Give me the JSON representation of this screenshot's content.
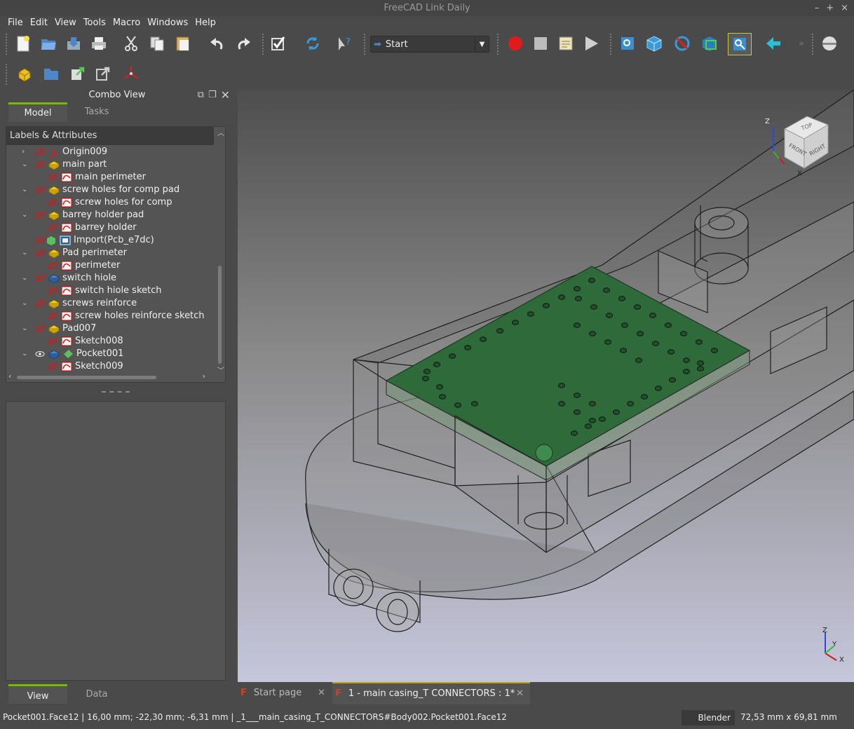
{
  "window": {
    "title": "FreeCAD Link Daily",
    "controls": [
      "–",
      "+",
      "×"
    ]
  },
  "menu": [
    "File",
    "Edit",
    "View",
    "Tools",
    "Macro",
    "Windows",
    "Help"
  ],
  "toolbar": {
    "workbench": "Start",
    "icons": [
      "new-file-icon",
      "open-file-icon",
      "save-icon",
      "print-icon",
      "cut-icon",
      "copy-icon",
      "paste-icon",
      "undo-icon",
      "redo-icon",
      "refresh-check-icon",
      "recompute-icon",
      "whats-this-icon",
      "record-macro-icon",
      "stop-macro-icon",
      "edit-macro-icon",
      "run-macro-icon",
      "fit-all-icon",
      "isometric-view-icon",
      "draw-style-icon",
      "bounding-box-icon",
      "fit-selection-icon",
      "back-arrow-icon",
      "view-menu-icon"
    ]
  },
  "combo": {
    "title": "Combo View",
    "tabs": [
      "Model",
      "Tasks"
    ],
    "tree_header": "Labels & Attributes",
    "items": [
      {
        "label": "Origin009",
        "indent": 0,
        "expand": ">",
        "icon": "origin"
      },
      {
        "label": "main part",
        "indent": 0,
        "expand": "v",
        "icon": "pad"
      },
      {
        "label": "main perimeter",
        "indent": 1,
        "expand": "",
        "icon": "sketch"
      },
      {
        "label": "screw holes for comp pad",
        "indent": 0,
        "expand": "v",
        "icon": "pad"
      },
      {
        "label": "screw holes for comp",
        "indent": 1,
        "expand": "",
        "icon": "sketch"
      },
      {
        "label": "barrey holder pad",
        "indent": 0,
        "expand": "v",
        "icon": "pad"
      },
      {
        "label": "barrey holder",
        "indent": 1,
        "expand": "",
        "icon": "sketch"
      },
      {
        "label": "Import(Pcb_e7dc)",
        "indent": 0,
        "expand": "",
        "icon": "import"
      },
      {
        "label": "Pad perimeter",
        "indent": 0,
        "expand": "v",
        "icon": "pad"
      },
      {
        "label": "perimeter",
        "indent": 1,
        "expand": "",
        "icon": "sketch"
      },
      {
        "label": "switch hiole",
        "indent": 0,
        "expand": "v",
        "icon": "pocket"
      },
      {
        "label": "switch hiole sketch",
        "indent": 1,
        "expand": "",
        "icon": "sketch"
      },
      {
        "label": "screws reinforce",
        "indent": 0,
        "expand": "v",
        "icon": "pad"
      },
      {
        "label": "screw holes reinforce sketch",
        "indent": 1,
        "expand": "",
        "icon": "sketch"
      },
      {
        "label": "Pad007",
        "indent": 0,
        "expand": "v",
        "icon": "pad"
      },
      {
        "label": "Sketch008",
        "indent": 1,
        "expand": "",
        "icon": "sketch"
      },
      {
        "label": "Pocket001",
        "indent": 0,
        "expand": "v",
        "icon": "pocket",
        "visible": true
      },
      {
        "label": "Sketch009",
        "indent": 1,
        "expand": "",
        "icon": "sketch"
      }
    ],
    "bottom_tabs": [
      "View",
      "Data"
    ]
  },
  "viewport": {
    "navcube": {
      "top": "TOP",
      "front": "FRONT",
      "right": "RIGHT",
      "axes": [
        "Z",
        "X"
      ]
    },
    "axis_labels": [
      "Z",
      "Y",
      "X"
    ]
  },
  "doc_tabs": [
    {
      "label": "Start page",
      "active": false
    },
    {
      "label": "1 - main casing_T CONNECTORS : 1*",
      "active": true
    }
  ],
  "status": {
    "text": "Pocket001.Face12 | 16,00 mm; -22,30 mm; -6,31 mm | _1___main_casing_T_CONNECTORS#Body002.Pocket001.Face12",
    "nav_style": "Blender",
    "dimensions": "72,53 mm x 69,81 mm"
  },
  "colors": {
    "pcb": "#2f6b3a",
    "accent_tab": "#7ab800",
    "doc_tab_accent": "#c8a000",
    "record": "#e01b1b"
  }
}
